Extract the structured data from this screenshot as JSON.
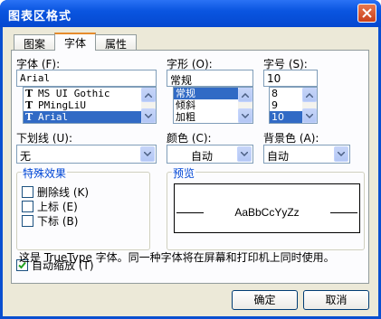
{
  "window": {
    "title": "图表区格式"
  },
  "tabs": [
    {
      "label": "图案"
    },
    {
      "label": "字体"
    },
    {
      "label": "属性"
    }
  ],
  "font": {
    "label": "字体 (F):",
    "value": "Arial",
    "options": [
      "MS UI Gothic",
      "PMingLiU",
      "Arial"
    ],
    "selected_index": 2
  },
  "style": {
    "label": "字形 (O):",
    "value": "常规",
    "options": [
      "常规",
      "倾斜",
      "加粗"
    ],
    "selected_index": 0
  },
  "size": {
    "label": "字号 (S):",
    "value": "10",
    "options": [
      "8",
      "9",
      "10"
    ],
    "selected_index": 2
  },
  "underline": {
    "label": "下划线 (U):",
    "value": "无"
  },
  "color": {
    "label": "颜色 (C):",
    "value": "自动"
  },
  "background": {
    "label": "背景色 (A):",
    "value": "自动"
  },
  "effects": {
    "title": "特殊效果",
    "strikethrough": {
      "label": "删除线 (K)",
      "checked": false
    },
    "superscript": {
      "label": "上标 (E)",
      "checked": false
    },
    "subscript": {
      "label": "下标 (B)",
      "checked": false
    }
  },
  "preview": {
    "title": "预览",
    "sample": "AaBbCcYyZz"
  },
  "autoscale": {
    "label": "自动缩放 (T)",
    "checked": true
  },
  "info_text": "这是 TrueType 字体。同一种字体将在屏幕和打印机上同时使用。",
  "buttons": {
    "ok": "确定",
    "cancel": "取消"
  },
  "colors": {
    "titlebar": "#0a55e0",
    "accent_tab": "#e68b2c",
    "selection": "#316ac5",
    "group_title": "#0046d5"
  }
}
